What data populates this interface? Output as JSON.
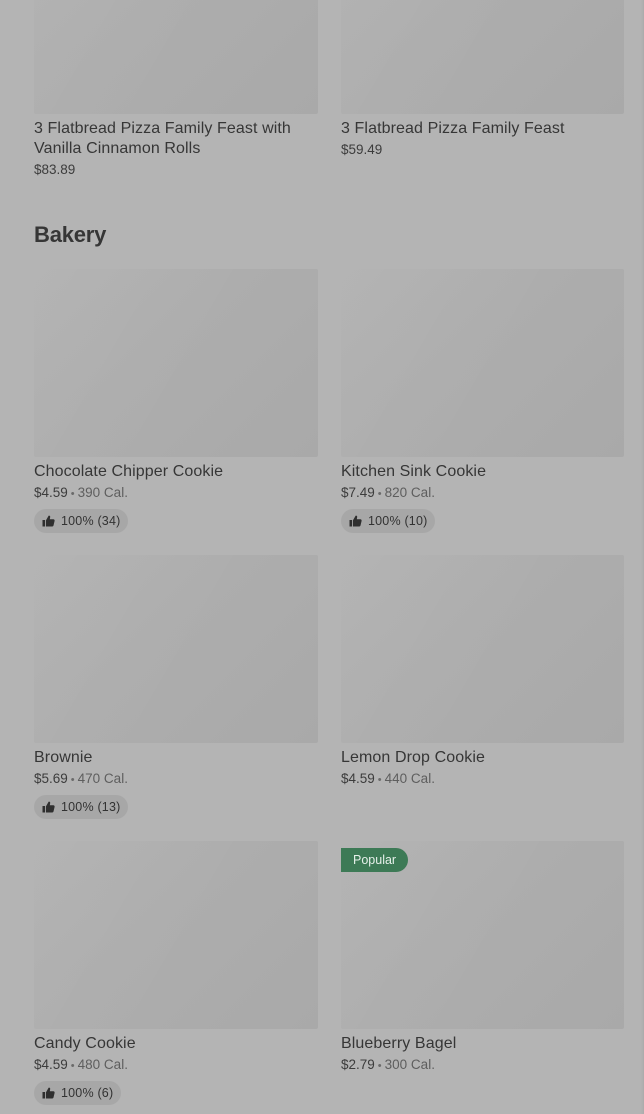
{
  "top_row": [
    {
      "title": "3 Flatbread Pizza Family Feast with Vanilla Cinnamon Rolls",
      "price": "$83.89"
    },
    {
      "title": "3 Flatbread Pizza Family Feast",
      "price": "$59.49"
    }
  ],
  "section": {
    "title": "Bakery"
  },
  "items": [
    {
      "title": "Chocolate Chipper Cookie",
      "price": "$4.59",
      "separator": "•",
      "calories": "390 Cal.",
      "rating": "100% (34)",
      "icon": "thumbs-up-icon"
    },
    {
      "title": "Kitchen Sink Cookie",
      "price": "$7.49",
      "separator": "•",
      "calories": "820 Cal.",
      "rating": "100% (10)",
      "icon": "thumbs-up-icon"
    },
    {
      "title": "Brownie",
      "price": "$5.69",
      "separator": "•",
      "calories": "470 Cal.",
      "rating": "100% (13)",
      "icon": "thumbs-up-icon"
    },
    {
      "title": "Lemon Drop Cookie",
      "price": "$4.59",
      "separator": "•",
      "calories": "440 Cal."
    },
    {
      "title": "Candy Cookie",
      "price": "$4.59",
      "separator": "•",
      "calories": "480 Cal.",
      "rating": "100% (6)",
      "icon": "thumbs-up-icon"
    },
    {
      "title": "Blueberry Bagel",
      "price": "$2.79",
      "separator": "•",
      "calories": "300 Cal.",
      "badge": "Popular"
    }
  ],
  "colors": {
    "page_overlay": "#b4b4b4",
    "image_placeholder": "#adadad",
    "rating_pill": "#a7a7a7",
    "popular_badge": "#3d7a56"
  }
}
